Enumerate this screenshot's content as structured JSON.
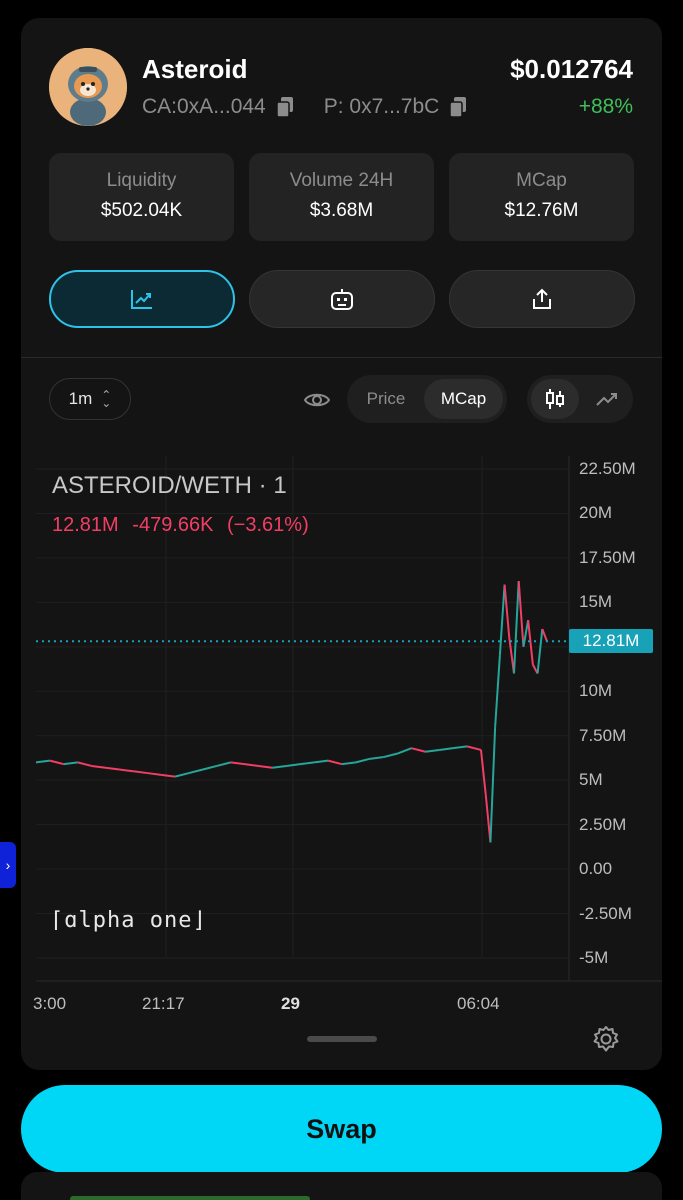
{
  "token": {
    "name": "Asteroid",
    "price": "$0.012764",
    "ca": "CA:0xA...044",
    "pair_addr": "P: 0x7...7bC",
    "change": "+88%"
  },
  "stats": [
    {
      "label": "Liquidity",
      "value": "$502.04K"
    },
    {
      "label": "Volume 24H",
      "value": "$3.68M"
    },
    {
      "label": "MCap",
      "value": "$12.76M"
    }
  ],
  "actions": {
    "icons": [
      "chart-icon",
      "robot-icon",
      "share-icon"
    ],
    "active": 0
  },
  "toolbar": {
    "timeframe": "1m",
    "mode_options": [
      "Price",
      "MCap"
    ],
    "mode_selected": "MCap"
  },
  "chart": {
    "pair_label": "ASTEROID/WETH · 1",
    "last": "12.81M",
    "change_abs": "-479.66K",
    "change_pct": "(−3.61%)",
    "current_tag": "12.81M",
    "watermark": "⌈ɑlpha one⌋",
    "colors": {
      "up": "#26a69a",
      "down": "#f23e65",
      "accent": "#17a2b8"
    }
  },
  "chart_data": {
    "type": "line",
    "title": "ASTEROID/WETH · 1",
    "y_ticks": [
      "22.50M",
      "20M",
      "17.50M",
      "15M",
      "12.50M",
      "10M",
      "7.50M",
      "5M",
      "2.50M",
      "0.00",
      "-2.50M",
      "-5M"
    ],
    "x_ticks": [
      "3:00",
      "21:17",
      "29",
      "06:04"
    ],
    "ylim": [
      -5,
      22.5
    ],
    "grid": true,
    "series": [
      {
        "values": [
          6.0,
          6.1,
          5.9,
          6.0,
          5.8,
          5.7,
          5.6,
          5.5,
          5.4,
          5.3,
          5.2,
          5.4,
          5.6,
          5.8,
          6.0,
          5.9,
          5.8,
          5.7,
          5.8,
          5.9,
          6.0,
          6.1,
          5.9,
          6.0,
          6.2,
          6.3,
          6.5,
          6.8,
          6.6,
          6.7,
          6.8,
          6.9,
          6.7,
          4.2,
          1.5,
          8.0,
          12.0,
          16.0,
          13.0,
          11.0,
          16.2,
          12.5,
          14.0,
          11.5,
          11.0,
          13.5,
          12.81
        ]
      }
    ]
  },
  "footer": {
    "swap_label": "Swap"
  }
}
